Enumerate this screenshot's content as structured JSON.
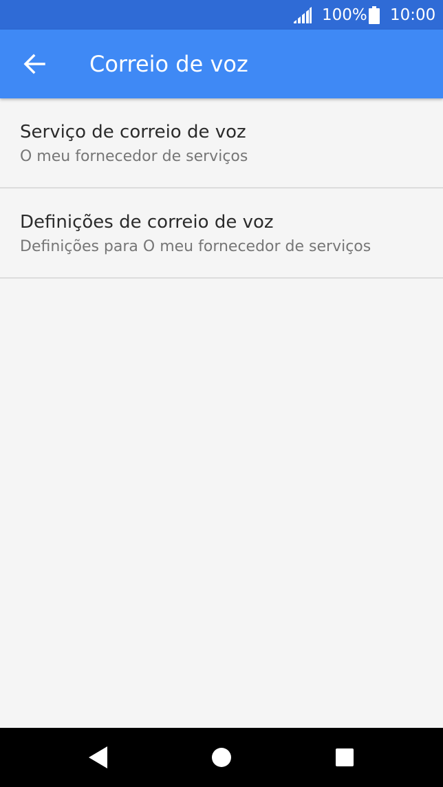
{
  "status_bar": {
    "battery_percent": "100%",
    "time": "10:00",
    "icons": [
      "cell-signal-icon",
      "battery-icon"
    ]
  },
  "app_bar": {
    "title": "Correio de voz",
    "back_icon": "arrow-left-icon"
  },
  "list": {
    "items": [
      {
        "title": "Serviço de correio de voz",
        "subtitle": "O meu fornecedor de serviços"
      },
      {
        "title": "Definições de correio de voz",
        "subtitle": "Definições para O meu fornecedor de serviços"
      }
    ]
  },
  "nav_bar": {
    "icons": [
      "nav-back-icon",
      "nav-home-icon",
      "nav-recents-icon"
    ]
  },
  "colors": {
    "status_bar": "#2f6bd6",
    "app_bar": "#3f89f5",
    "background": "#f5f5f5",
    "primary_text": "#2b2b2b",
    "secondary_text": "#767676",
    "divider": "#dcdcdc"
  }
}
